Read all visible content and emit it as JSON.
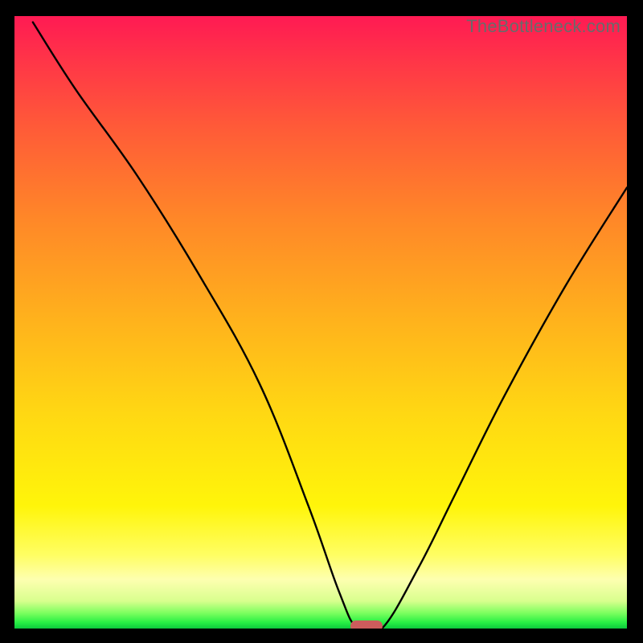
{
  "watermark": "TheBottleneck.com",
  "chart_data": {
    "type": "line",
    "title": "",
    "xlabel": "",
    "ylabel": "",
    "xlim": [
      0,
      100
    ],
    "ylim": [
      0,
      100
    ],
    "grid": false,
    "series": [
      {
        "name": "bottleneck-curve",
        "x": [
          3,
          10,
          20,
          30,
          40,
          48,
          53,
          56,
          60,
          66,
          72,
          80,
          90,
          100
        ],
        "y": [
          99,
          88,
          74,
          58,
          40,
          20,
          6,
          0,
          0,
          10,
          22,
          38,
          56,
          72
        ]
      }
    ],
    "annotations": [
      {
        "name": "optimal-marker",
        "x": 57.5,
        "y": 0.4,
        "color": "#cd5c5c"
      }
    ]
  },
  "colors": {
    "curve": "#000000",
    "background_black": "#000000",
    "marker": "#cd5c5c"
  }
}
